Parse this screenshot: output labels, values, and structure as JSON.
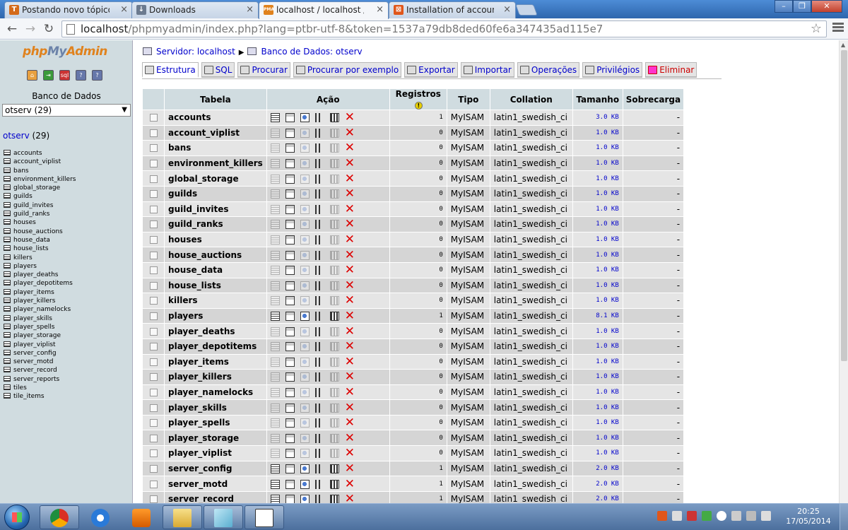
{
  "browser": {
    "tabs": [
      {
        "title": "Postando novo tópico - Ti",
        "favicon": "T",
        "color": "#d46a1a"
      },
      {
        "title": "Downloads",
        "favicon": "↓",
        "color": "#6b7a8f"
      },
      {
        "title": "localhost / localhost / ots",
        "favicon": "PMA",
        "color": "#e0821d"
      },
      {
        "title": "Installation of account ma",
        "favicon": "⊠",
        "color": "#e0561a"
      }
    ],
    "url_host": "localhost",
    "url_rest": "/phpmyadmin/index.php?lang=ptbr-utf-8&token=1537a79db8ded60fe6a347435ad115e7"
  },
  "left": {
    "logo_php": "php",
    "logo_my": "My",
    "logo_admin": "Admin",
    "db_label": "Banco de Dados",
    "db_select": "otserv (29)",
    "db_title": "otserv",
    "db_count": " (29)",
    "tables": [
      "accounts",
      "account_viplist",
      "bans",
      "environment_killers",
      "global_storage",
      "guilds",
      "guild_invites",
      "guild_ranks",
      "houses",
      "house_auctions",
      "house_data",
      "house_lists",
      "killers",
      "players",
      "player_deaths",
      "player_depotitems",
      "player_items",
      "player_killers",
      "player_namelocks",
      "player_skills",
      "player_spells",
      "player_storage",
      "player_viplist",
      "server_config",
      "server_motd",
      "server_record",
      "server_reports",
      "tiles",
      "tile_items"
    ]
  },
  "main": {
    "crumb_server": "Servidor: localhost",
    "crumb_db": "Banco de Dados: otserv",
    "tabs": [
      "Estrutura",
      "SQL",
      "Procurar",
      "Procurar por exemplo",
      "Exportar",
      "Importar",
      "Operações",
      "Privilégios",
      "Eliminar"
    ],
    "headers": {
      "table": "Tabela",
      "action": "Ação",
      "records": "Registros",
      "type": "Tipo",
      "collation": "Collation",
      "size": "Tamanho",
      "overhead": "Sobrecarga"
    },
    "rows": [
      {
        "name": "accounts",
        "records": "1",
        "type": "MyISAM",
        "collation": "latin1_swedish_ci",
        "size": "3.0 KB",
        "overhead": "-"
      },
      {
        "name": "account_viplist",
        "records": "0",
        "type": "MyISAM",
        "collation": "latin1_swedish_ci",
        "size": "1.0 KB",
        "overhead": "-"
      },
      {
        "name": "bans",
        "records": "0",
        "type": "MyISAM",
        "collation": "latin1_swedish_ci",
        "size": "1.0 KB",
        "overhead": "-"
      },
      {
        "name": "environment_killers",
        "records": "0",
        "type": "MyISAM",
        "collation": "latin1_swedish_ci",
        "size": "1.0 KB",
        "overhead": "-"
      },
      {
        "name": "global_storage",
        "records": "0",
        "type": "MyISAM",
        "collation": "latin1_swedish_ci",
        "size": "1.0 KB",
        "overhead": "-"
      },
      {
        "name": "guilds",
        "records": "0",
        "type": "MyISAM",
        "collation": "latin1_swedish_ci",
        "size": "1.0 KB",
        "overhead": "-"
      },
      {
        "name": "guild_invites",
        "records": "0",
        "type": "MyISAM",
        "collation": "latin1_swedish_ci",
        "size": "1.0 KB",
        "overhead": "-"
      },
      {
        "name": "guild_ranks",
        "records": "0",
        "type": "MyISAM",
        "collation": "latin1_swedish_ci",
        "size": "1.0 KB",
        "overhead": "-"
      },
      {
        "name": "houses",
        "records": "0",
        "type": "MyISAM",
        "collation": "latin1_swedish_ci",
        "size": "1.0 KB",
        "overhead": "-"
      },
      {
        "name": "house_auctions",
        "records": "0",
        "type": "MyISAM",
        "collation": "latin1_swedish_ci",
        "size": "1.0 KB",
        "overhead": "-"
      },
      {
        "name": "house_data",
        "records": "0",
        "type": "MyISAM",
        "collation": "latin1_swedish_ci",
        "size": "1.0 KB",
        "overhead": "-"
      },
      {
        "name": "house_lists",
        "records": "0",
        "type": "MyISAM",
        "collation": "latin1_swedish_ci",
        "size": "1.0 KB",
        "overhead": "-"
      },
      {
        "name": "killers",
        "records": "0",
        "type": "MyISAM",
        "collation": "latin1_swedish_ci",
        "size": "1.0 KB",
        "overhead": "-"
      },
      {
        "name": "players",
        "records": "1",
        "type": "MyISAM",
        "collation": "latin1_swedish_ci",
        "size": "8.1 KB",
        "overhead": "-"
      },
      {
        "name": "player_deaths",
        "records": "0",
        "type": "MyISAM",
        "collation": "latin1_swedish_ci",
        "size": "1.0 KB",
        "overhead": "-"
      },
      {
        "name": "player_depotitems",
        "records": "0",
        "type": "MyISAM",
        "collation": "latin1_swedish_ci",
        "size": "1.0 KB",
        "overhead": "-"
      },
      {
        "name": "player_items",
        "records": "0",
        "type": "MyISAM",
        "collation": "latin1_swedish_ci",
        "size": "1.0 KB",
        "overhead": "-"
      },
      {
        "name": "player_killers",
        "records": "0",
        "type": "MyISAM",
        "collation": "latin1_swedish_ci",
        "size": "1.0 KB",
        "overhead": "-"
      },
      {
        "name": "player_namelocks",
        "records": "0",
        "type": "MyISAM",
        "collation": "latin1_swedish_ci",
        "size": "1.0 KB",
        "overhead": "-"
      },
      {
        "name": "player_skills",
        "records": "0",
        "type": "MyISAM",
        "collation": "latin1_swedish_ci",
        "size": "1.0 KB",
        "overhead": "-"
      },
      {
        "name": "player_spells",
        "records": "0",
        "type": "MyISAM",
        "collation": "latin1_swedish_ci",
        "size": "1.0 KB",
        "overhead": "-"
      },
      {
        "name": "player_storage",
        "records": "0",
        "type": "MyISAM",
        "collation": "latin1_swedish_ci",
        "size": "1.0 KB",
        "overhead": "-"
      },
      {
        "name": "player_viplist",
        "records": "0",
        "type": "MyISAM",
        "collation": "latin1_swedish_ci",
        "size": "1.0 KB",
        "overhead": "-"
      },
      {
        "name": "server_config",
        "records": "1",
        "type": "MyISAM",
        "collation": "latin1_swedish_ci",
        "size": "2.0 KB",
        "overhead": "-"
      },
      {
        "name": "server_motd",
        "records": "1",
        "type": "MyISAM",
        "collation": "latin1_swedish_ci",
        "size": "2.0 KB",
        "overhead": "-"
      },
      {
        "name": "server_record",
        "records": "1",
        "type": "MyISAM",
        "collation": "latin1_swedish_ci",
        "size": "2.0 KB",
        "overhead": "-"
      }
    ]
  },
  "taskbar": {
    "time": "20:25",
    "date": "17/05/2014"
  },
  "colors": {
    "tab_active": "#f4f6f9",
    "header_bg": "#d0dce0",
    "link": "#0000cc",
    "danger": "#cc0000"
  }
}
